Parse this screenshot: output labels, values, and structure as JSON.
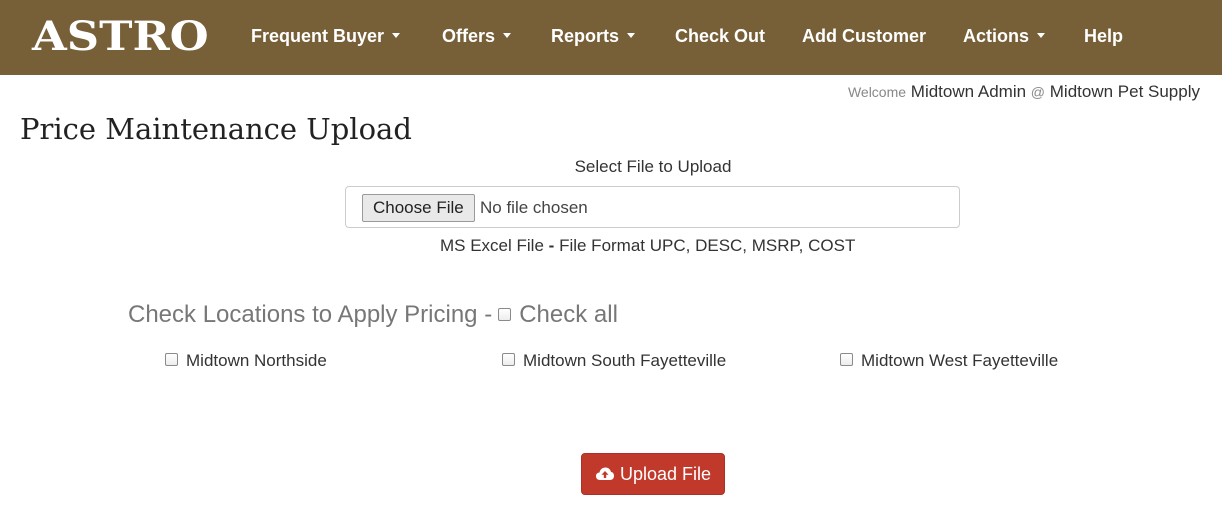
{
  "navbar": {
    "brand": "ASTRO",
    "items": [
      {
        "label": "Frequent Buyer",
        "dropdown": true
      },
      {
        "label": "Offers",
        "dropdown": true
      },
      {
        "label": "Reports",
        "dropdown": true
      },
      {
        "label": "Check Out",
        "dropdown": false
      },
      {
        "label": "Add Customer",
        "dropdown": false
      },
      {
        "label": "Actions",
        "dropdown": true
      },
      {
        "label": "Help",
        "dropdown": false
      }
    ],
    "background": "#775f38"
  },
  "user": {
    "welcome": "Welcome",
    "name": "Midtown Admin",
    "at": "@",
    "store": "Midtown Pet Supply"
  },
  "page": {
    "title": "Price Maintenance Upload"
  },
  "upload": {
    "select_label": "Select File to Upload",
    "choose_button": "Choose File",
    "file_status": "No file chosen",
    "hint_prefix": "MS Excel File",
    "hint_separator": "-",
    "hint_suffix": "File Format UPC, DESC, MSRP, COST"
  },
  "locations": {
    "heading": "Check Locations to Apply Pricing -",
    "check_all": "Check all",
    "items": [
      {
        "label": "Midtown Northside",
        "checked": false
      },
      {
        "label": "Midtown South Fayetteville",
        "checked": false
      },
      {
        "label": "Midtown West Fayetteville",
        "checked": false
      }
    ]
  },
  "actions": {
    "upload_label": "Upload File",
    "upload_icon": "cloud-upload-icon",
    "upload_color": "#c0392b"
  }
}
